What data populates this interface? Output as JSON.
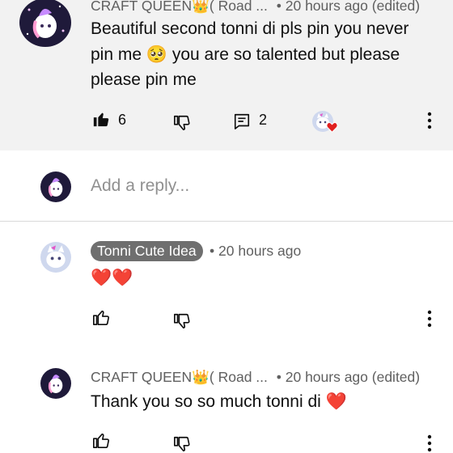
{
  "parent_comment": {
    "author": "CRAFT QUEEN👑( Road ...",
    "meta": "• 20 hours ago (edited)",
    "text": "Beautiful second tonni di pls pin you never pin me 🥺 you are so talented but please please pin me",
    "likes": "6",
    "replies": "2",
    "liked": true,
    "creator_heart": true
  },
  "reply_box": {
    "placeholder": "Add a reply..."
  },
  "replies": [
    {
      "author": "Tonni Cute Idea",
      "author_is_creator": true,
      "meta": "• 20 hours ago",
      "text": "❤️❤️"
    },
    {
      "author": "CRAFT QUEEN👑( Road ...",
      "meta": "• 20 hours ago (edited)",
      "text": "Thank  you so so much tonni di ❤️"
    }
  ],
  "colors": {
    "parent_bg": "#f2f2f2",
    "chip_bg": "#6f6f6f",
    "heart_red": "#e02020",
    "meta_gray": "#606060",
    "avatar_dark": "#1f1a3a",
    "avatar_light": "#cfd8ee"
  },
  "icons": [
    "like-icon",
    "dislike-icon",
    "reply-icon",
    "more-icon",
    "unicorn-avatar",
    "cat-avatar",
    "heart-badge"
  ]
}
